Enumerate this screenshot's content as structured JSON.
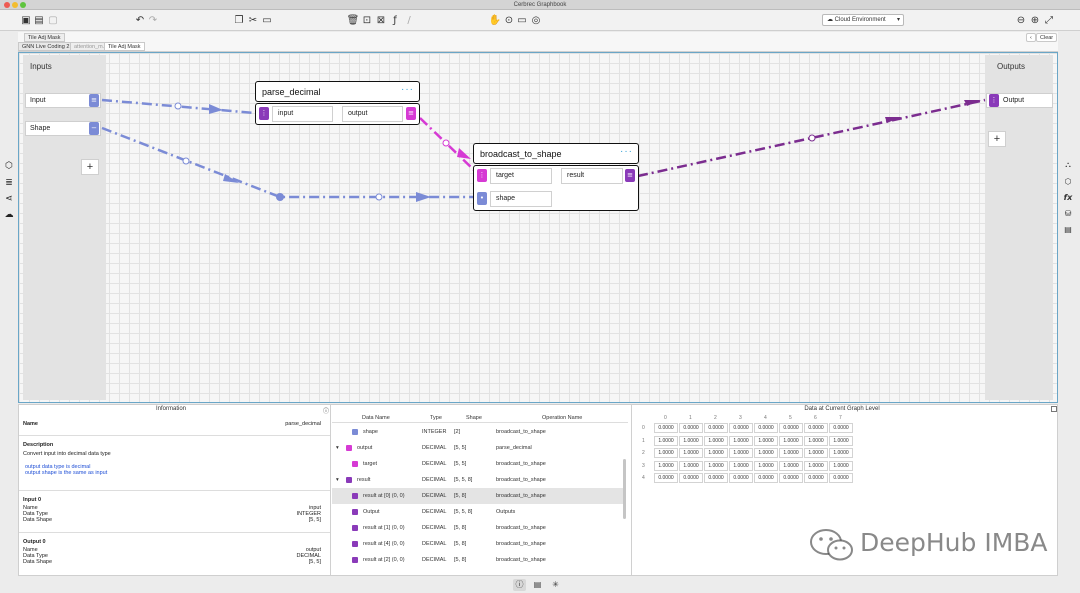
{
  "window": {
    "title": "Cerbrec Graphbook"
  },
  "colors": {
    "node_purple": "#8a3ab9",
    "node_magenta": "#d63ad4",
    "edge_blue": "#7b8bd6",
    "edge_purple": "#7b2c8f",
    "accent": "#32a0d4"
  },
  "toolbar": {
    "icons": [
      "save-icon",
      "save-all-icon",
      "export-icon",
      "undo-icon",
      "redo-icon",
      "copy-icon",
      "cut-icon",
      "paste-icon",
      "delete-icon",
      "group-icon",
      "ungroup-icon",
      "function-icon",
      "comment-icon",
      "hand-icon",
      "pointer-icon",
      "chat-icon",
      "zoom-out-icon",
      "zoom-in-icon",
      "fullscreen-icon"
    ],
    "environment": "Cloud Environment"
  },
  "breadcrumb": {
    "current": "Tile Adj Mask"
  },
  "tabs": [
    {
      "label": "GNN Live Coding 2"
    },
    {
      "label": "attention_m..."
    },
    {
      "label": "Tile Adj Mask"
    }
  ],
  "clear_label": "Clear",
  "canvas": {
    "inputs_title": "Inputs",
    "outputs_title": "Outputs",
    "inputs": [
      "Input",
      "Shape"
    ],
    "outputs": [
      "Output"
    ],
    "add_symbol": "+",
    "nodes": [
      {
        "title": "parse_decimal",
        "menu": "···",
        "fields": {
          "in": "input",
          "out": "output"
        }
      },
      {
        "title": "broadcast_to_shape",
        "menu": "···",
        "fields": {
          "in1": "target",
          "out": "result",
          "in2": "shape"
        }
      }
    ]
  },
  "information": {
    "title": "Information",
    "name_label": "Name",
    "name_value": "parse_decimal",
    "description_label": "Description",
    "description_text": "Convert input into decimal data type",
    "bullets": [
      "output data type is decimal",
      "output shape is the same as input"
    ],
    "input0": {
      "title": "Input 0",
      "labels": [
        "Name",
        "Data Type",
        "Data Shape"
      ],
      "values": [
        "input",
        "INTEGER",
        "[5, 5]"
      ]
    },
    "output0": {
      "title": "Output 0",
      "labels": [
        "Name",
        "Data Type",
        "Data Shape"
      ],
      "values": [
        "output",
        "DECIMAL",
        "[5, 5]"
      ]
    }
  },
  "data_table": {
    "headers": [
      "Data Name",
      "Type",
      "Shape",
      "Operation Name"
    ],
    "rows": [
      {
        "name": "shape",
        "type": "INTEGER",
        "shape": "[2]",
        "op": "broadcast_to_shape",
        "badge": "#7b8bd6",
        "indent": 1,
        "expander": "",
        "selected": false
      },
      {
        "name": "output",
        "type": "DECIMAL",
        "shape": "[5, 5]",
        "op": "parse_decimal",
        "badge": "#d63ad4",
        "indent": 0,
        "expander": "▾",
        "selected": false
      },
      {
        "name": "target",
        "type": "DECIMAL",
        "shape": "[5, 5]",
        "op": "broadcast_to_shape",
        "badge": "#d63ad4",
        "indent": 1,
        "expander": "",
        "selected": false
      },
      {
        "name": "result",
        "type": "DECIMAL",
        "shape": "[5, 5, 8]",
        "op": "broadcast_to_shape",
        "badge": "#8a3ab9",
        "indent": 0,
        "expander": "▾",
        "selected": false
      },
      {
        "name": "result at [0] (0, 0)",
        "type": "DECIMAL",
        "shape": "[5, 8]",
        "op": "broadcast_to_shape",
        "badge": "#8a3ab9",
        "indent": 1,
        "expander": "",
        "selected": true
      },
      {
        "name": "Output",
        "type": "DECIMAL",
        "shape": "[5, 5, 8]",
        "op": "Outputs",
        "badge": "#8a3ab9",
        "indent": 1,
        "expander": "",
        "selected": false
      },
      {
        "name": "result at [1] (0, 0)",
        "type": "DECIMAL",
        "shape": "[5, 8]",
        "op": "broadcast_to_shape",
        "badge": "#8a3ab9",
        "indent": 1,
        "expander": "",
        "selected": false
      },
      {
        "name": "result at [4] (0, 0)",
        "type": "DECIMAL",
        "shape": "[5, 8]",
        "op": "broadcast_to_shape",
        "badge": "#8a3ab9",
        "indent": 1,
        "expander": "",
        "selected": false
      },
      {
        "name": "result at [2] (0, 0)",
        "type": "DECIMAL",
        "shape": "[5, 8]",
        "op": "broadcast_to_shape",
        "badge": "#8a3ab9",
        "indent": 1,
        "expander": "",
        "selected": false
      }
    ]
  },
  "graph_level": {
    "title": "Data at Current Graph Level",
    "col_headers": [
      "0",
      "1",
      "2",
      "3",
      "4",
      "5",
      "6",
      "7"
    ],
    "row_headers": [
      "0",
      "1",
      "2",
      "3",
      "4"
    ],
    "values": [
      [
        "0.0000",
        "0.0000",
        "0.0000",
        "0.0000",
        "0.0000",
        "0.0000",
        "0.0000",
        "0.0000"
      ],
      [
        "1.0000",
        "1.0000",
        "1.0000",
        "1.0000",
        "1.0000",
        "1.0000",
        "1.0000",
        "1.0000"
      ],
      [
        "1.0000",
        "1.0000",
        "1.0000",
        "1.0000",
        "1.0000",
        "1.0000",
        "1.0000",
        "1.0000"
      ],
      [
        "1.0000",
        "1.0000",
        "1.0000",
        "1.0000",
        "1.0000",
        "1.0000",
        "1.0000",
        "1.0000"
      ],
      [
        "0.0000",
        "0.0000",
        "0.0000",
        "0.0000",
        "0.0000",
        "0.0000",
        "0.0000",
        "0.0000"
      ]
    ]
  },
  "statusbar": {
    "icons": [
      "info-icon",
      "table-icon",
      "graph-icon"
    ]
  },
  "watermark": {
    "text": "DeepHub IMBA"
  }
}
